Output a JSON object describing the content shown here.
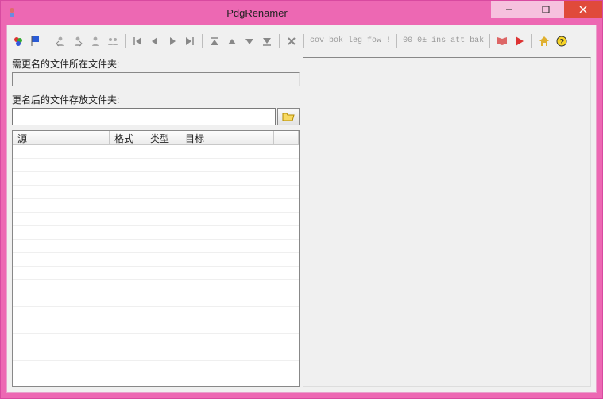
{
  "window": {
    "title": "PdgRenamer"
  },
  "toolbar": {
    "text_buttons": {
      "cov": "cov",
      "bok": "bok",
      "leg": "leg",
      "fow": "fow",
      "exc": "!",
      "zz1": "00",
      "zz2": "0±",
      "ins": "ins",
      "att": "att",
      "bak": "bak"
    }
  },
  "panel": {
    "src_label": "需更名的文件所在文件夹:",
    "src_value": "",
    "dst_label": "更名后的文件存放文件夹:",
    "dst_value": ""
  },
  "table": {
    "columns": {
      "source": "源",
      "format": "格式",
      "type": "类型",
      "target": "目标"
    },
    "rows": []
  }
}
